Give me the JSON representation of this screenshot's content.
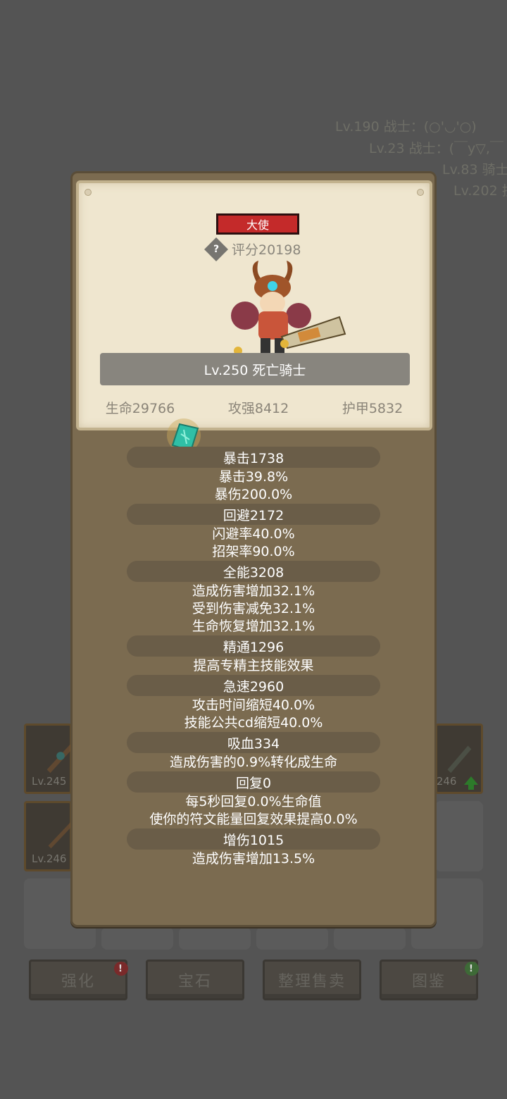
{
  "background": {
    "log_lines": [
      "Lv.190 战士：(○'◡'○)",
      "Lv.23 战士：(￣y▽,￣",
      "Lv.83 骑士",
      "Lv.202 技"
    ],
    "inventory": [
      {
        "level": "Lv.245"
      },
      {
        "level": "Lv.246"
      },
      {
        "level": "Lv.246"
      }
    ],
    "buttons": [
      {
        "label": "强化",
        "badge": "!"
      },
      {
        "label": "宝石",
        "badge": ""
      },
      {
        "label": "整理售卖",
        "badge": ""
      },
      {
        "label": "图鉴",
        "badge": "!"
      }
    ]
  },
  "popup": {
    "rank": "大使",
    "help_icon": "question-mark",
    "score": "评分20198",
    "name": "Lv.250 死亡骑士",
    "base_stats": {
      "hp": "生命29766",
      "attack": "攻强8412",
      "armor": "护甲5832"
    },
    "stats": [
      {
        "head": "暴击1738",
        "details": [
          "暴击39.8%",
          "暴伤200.0%"
        ]
      },
      {
        "head": "回避2172",
        "details": [
          "闪避率40.0%",
          "招架率90.0%"
        ]
      },
      {
        "head": "全能3208",
        "details": [
          "造成伤害增加32.1%",
          "受到伤害减免32.1%",
          "生命恢复增加32.1%"
        ]
      },
      {
        "head": "精通1296",
        "details": [
          "提高专精主技能效果"
        ]
      },
      {
        "head": "急速2960",
        "details": [
          "攻击时间缩短40.0%",
          "技能公共cd缩短40.0%"
        ]
      },
      {
        "head": "吸血334",
        "details": [
          "造成伤害的0.9%转化成生命"
        ]
      },
      {
        "head": "回复0",
        "details": [
          "每5秒回复0.0%生命值",
          "使你的符文能量回复效果提高0.0%"
        ]
      },
      {
        "head": "增伤1015",
        "details": [
          "造成伤害增加13.5%"
        ]
      }
    ]
  }
}
